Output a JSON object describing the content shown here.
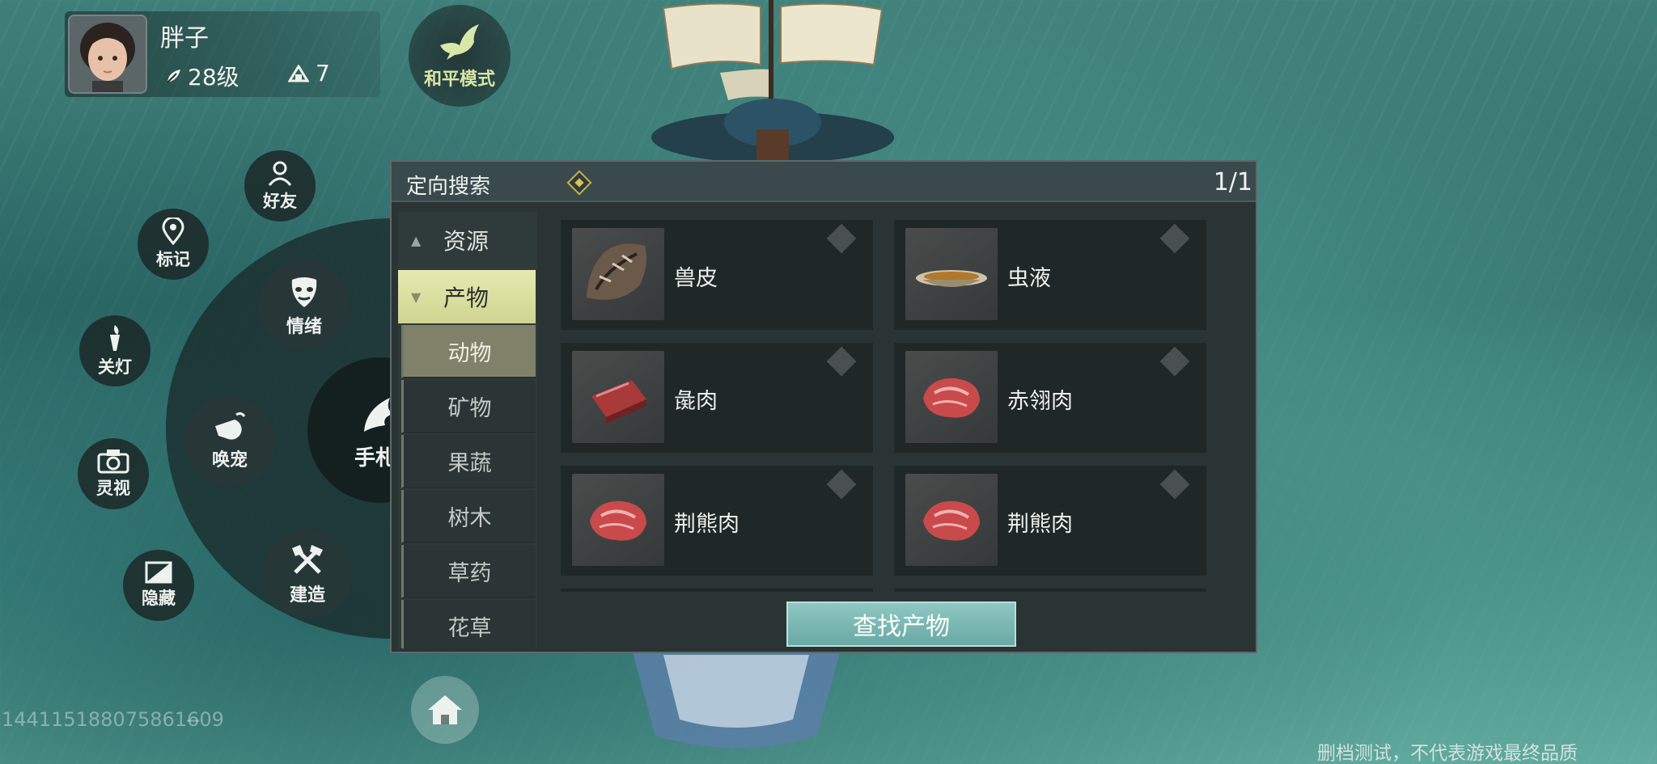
{
  "player": {
    "name": "胖子",
    "level": "28级",
    "stat": "7"
  },
  "peace_mode": {
    "label": "和平模式"
  },
  "side_buttons": {
    "friends": "好友",
    "mark": "标记",
    "emotion": "情绪",
    "lights_off": "关灯",
    "summon_pet": "唤宠",
    "spirit_vision": "灵视",
    "build": "建造",
    "hide": "隐藏",
    "center": "手札"
  },
  "panel": {
    "title": "定向搜索",
    "page": "1/1",
    "categories": [
      {
        "label": "资源",
        "state": "collapsed"
      },
      {
        "label": "产物",
        "state": "expanded"
      }
    ],
    "subcategories": [
      "动物",
      "矿物",
      "果蔬",
      "树木",
      "草药",
      "花草"
    ],
    "active_subcategory": "动物",
    "items": [
      {
        "name": "兽皮",
        "icon": "hide-pelt-icon"
      },
      {
        "name": "虫液",
        "icon": "bowl-liquid-icon"
      },
      {
        "name": "彘肉",
        "icon": "meat-slab-icon"
      },
      {
        "name": "赤翎肉",
        "icon": "raw-meat-icon"
      },
      {
        "name": "荆熊肉",
        "icon": "raw-meat-icon"
      },
      {
        "name": "荆熊肉",
        "icon": "raw-meat-icon"
      }
    ],
    "find_button": "查找产物"
  },
  "uid": "1441151880758616̶09",
  "disclaimer": "删档测试，不代表游戏最终品质"
}
